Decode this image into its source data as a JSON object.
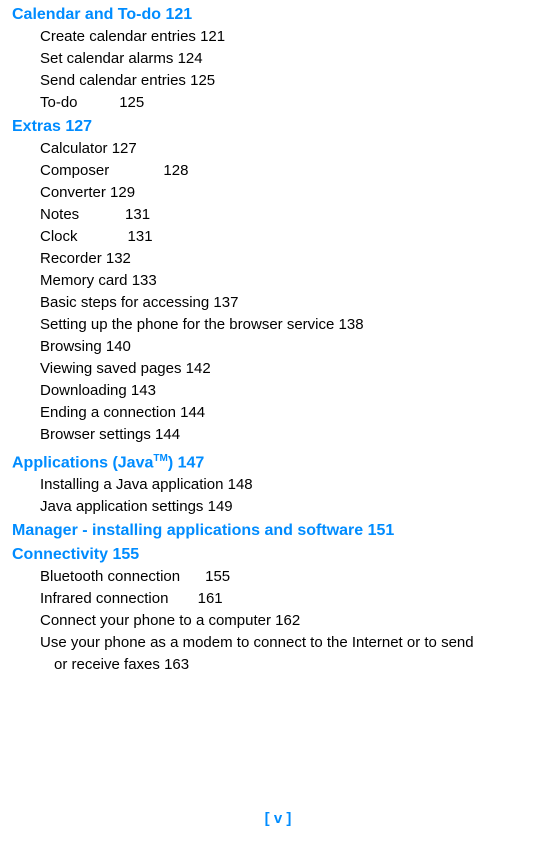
{
  "sections": [
    {
      "heading": "Calendar and To-do",
      "heading_page": "121",
      "entries": [
        {
          "title": "Create calendar entries",
          "gap": " ",
          "page": "121"
        },
        {
          "title": "Set calendar alarms",
          "gap": " ",
          "page": "124"
        },
        {
          "title": "Send calendar entries",
          "gap": " ",
          "page": "125"
        },
        {
          "title": "To-do",
          "gap": "          ",
          "page": "125"
        }
      ]
    },
    {
      "heading": "Extras",
      "heading_page": "127",
      "entries": [
        {
          "title": "Calculator",
          "gap": " ",
          "page": "127"
        },
        {
          "title": "Composer",
          "gap": "             ",
          "page": "128"
        },
        {
          "title": "Converter",
          "gap": " ",
          "page": "129"
        },
        {
          "title": "Notes",
          "gap": "           ",
          "page": "131"
        },
        {
          "title": "Clock",
          "gap": "            ",
          "page": "131"
        },
        {
          "title": "Recorder",
          "gap": " ",
          "page": "132"
        },
        {
          "title": "Memory card",
          "gap": " ",
          "page": "133"
        },
        {
          "title": "Basic steps for accessing",
          "gap": " ",
          "page": "137"
        },
        {
          "title": "Setting up the phone for the browser service",
          "gap": " ",
          "page": "138"
        },
        {
          "title": "Browsing",
          "gap": " ",
          "page": "140"
        },
        {
          "title": "Viewing saved pages",
          "gap": " ",
          "page": "142"
        },
        {
          "title": "Downloading",
          "gap": " ",
          "page": "143"
        },
        {
          "title": "Ending a connection",
          "gap": " ",
          "page": "144"
        },
        {
          "title": "Browser settings",
          "gap": " ",
          "page": "144"
        }
      ]
    },
    {
      "heading_parts": {
        "pre": "Applications (Java",
        "tm": "TM",
        "post": ")"
      },
      "heading_page": "147",
      "entries": [
        {
          "title": "Installing a Java application",
          "gap": " ",
          "page": "148"
        },
        {
          "title": "Java application settings",
          "gap": " ",
          "page": "149"
        }
      ]
    },
    {
      "heading": "Manager - installing applications and software",
      "heading_page": "151",
      "entries": []
    },
    {
      "heading": "Connectivity",
      "heading_page": "155",
      "entries": [
        {
          "title": "Bluetooth connection",
          "gap": "      ",
          "page": "155"
        },
        {
          "title": "Infrared connection",
          "gap": "       ",
          "page": "161"
        },
        {
          "title": "Connect your phone to a computer",
          "gap": " ",
          "page": "162"
        },
        {
          "title": "Use your phone as a modem to connect to the Internet or to send",
          "cont": "or receive faxes",
          "gap": " ",
          "page": "163",
          "wrapped": true
        }
      ]
    }
  ],
  "footer": "[ v ]"
}
